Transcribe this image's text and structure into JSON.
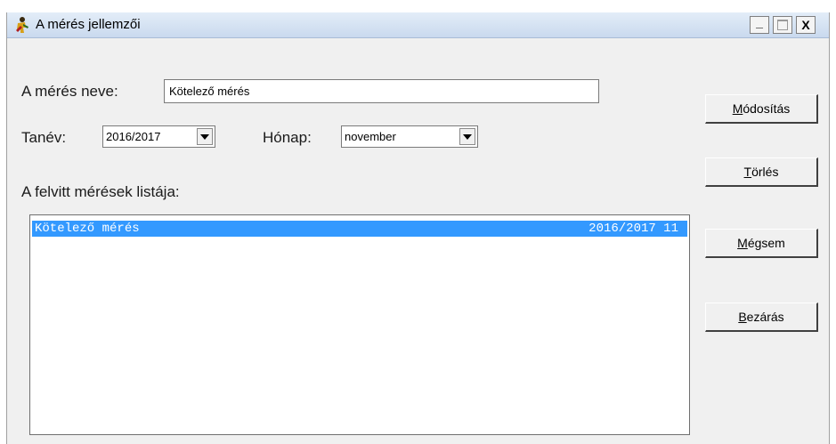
{
  "window": {
    "title": "A mérés jellemzői",
    "controls": {
      "minimize": "_",
      "close": "X"
    }
  },
  "form": {
    "name_label": "A mérés neve:",
    "name_value": "Kötelező mérés",
    "year_label": "Tanév:",
    "year_value": "2016/2017",
    "month_label": "Hónap:",
    "month_value": "november",
    "list_label": "A felvitt mérések listája:"
  },
  "list": {
    "items": [
      {
        "name": "Kötelező mérés",
        "period": "2016/2017 11",
        "selected": true
      }
    ],
    "selection_color": "#3399ff"
  },
  "buttons": {
    "modify": {
      "mnemonic": "M",
      "rest": "ódosítás"
    },
    "delete": {
      "mnemonic": "T",
      "rest": "örlés"
    },
    "cancel": {
      "mnemonic": "M",
      "rest": "égsem"
    },
    "close": {
      "mnemonic": "B",
      "rest": "ezárás"
    }
  },
  "icons": {
    "app": "app-person-icon",
    "minimize": "minimize-icon",
    "maximize": "maximize-icon",
    "close": "close-icon",
    "dropdown": "chevron-down-icon"
  }
}
